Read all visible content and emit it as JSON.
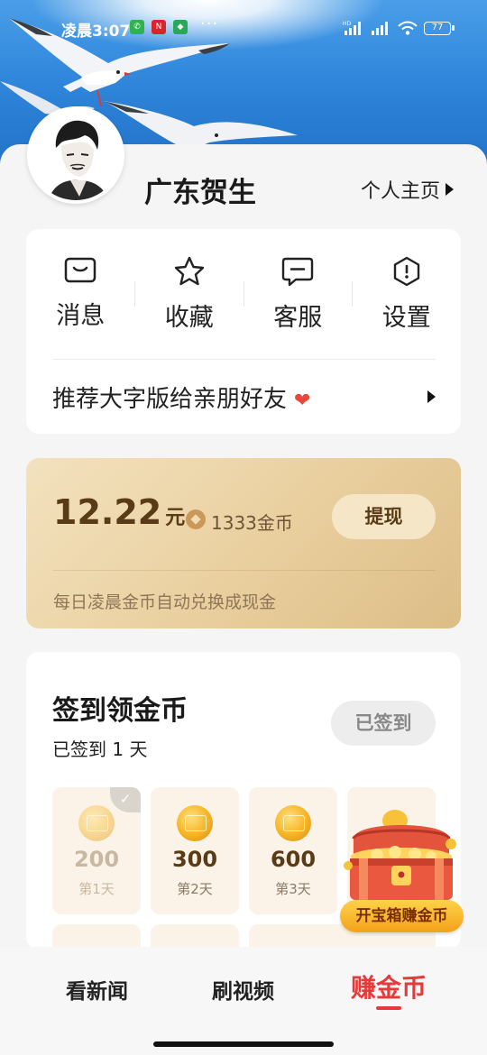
{
  "status_bar": {
    "time": "凌晨3:07",
    "app_badges": [
      "phone-icon",
      "news-icon",
      "shield-icon"
    ],
    "more": "···",
    "battery": "77",
    "net_tag": "HD"
  },
  "profile": {
    "name": "广东贺生",
    "homepage_label": "个人主页"
  },
  "menu": {
    "items": [
      {
        "label": "消息",
        "icon": "message-icon"
      },
      {
        "label": "收藏",
        "icon": "star-icon"
      },
      {
        "label": "客服",
        "icon": "customer-service-icon"
      },
      {
        "label": "设置",
        "icon": "settings-icon"
      }
    ],
    "recommend": "推荐大字版给亲朋好友",
    "heart": "❤"
  },
  "wallet": {
    "amount": "12.22",
    "unit": "元",
    "coins": "1333金币",
    "withdraw_label": "提现",
    "note": "每日凌晨金币自动兑换成现金"
  },
  "signin": {
    "title": "签到领金币",
    "subtitle": "已签到 1 天",
    "button": "已签到",
    "days": [
      {
        "value": "200",
        "label": "第1天",
        "done": true
      },
      {
        "value": "300",
        "label": "第2天",
        "done": false
      },
      {
        "value": "600",
        "label": "第3天",
        "done": false
      }
    ],
    "treasure_label": "开宝箱赚金币"
  },
  "bottom_nav": {
    "tabs": [
      "看新闻",
      "刷视频",
      "赚金币"
    ],
    "active_index": 2
  },
  "colors": {
    "accent": "#e8383a",
    "gold_text": "#5a3b17",
    "sky": "#2f86db"
  }
}
